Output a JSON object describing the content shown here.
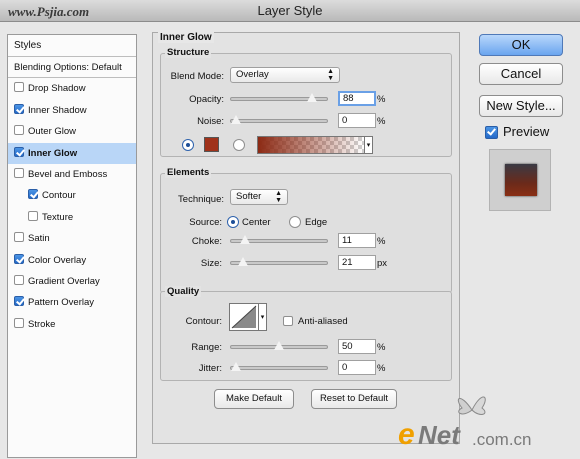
{
  "window": {
    "title": "Layer Style",
    "watermark": "www.Psjia.com"
  },
  "sidebar": {
    "header": "Styles",
    "items": [
      {
        "label": "Blending Options: Default",
        "checkbox": false,
        "checked": false,
        "selected": false,
        "indent": false
      },
      {
        "label": "Drop Shadow",
        "checkbox": true,
        "checked": false,
        "selected": false,
        "indent": false
      },
      {
        "label": "Inner Shadow",
        "checkbox": true,
        "checked": true,
        "selected": false,
        "indent": false
      },
      {
        "label": "Outer Glow",
        "checkbox": true,
        "checked": false,
        "selected": false,
        "indent": false
      },
      {
        "label": "Inner Glow",
        "checkbox": true,
        "checked": true,
        "selected": true,
        "indent": false
      },
      {
        "label": "Bevel and Emboss",
        "checkbox": true,
        "checked": false,
        "selected": false,
        "indent": false
      },
      {
        "label": "Contour",
        "checkbox": true,
        "checked": true,
        "selected": false,
        "indent": true
      },
      {
        "label": "Texture",
        "checkbox": true,
        "checked": false,
        "selected": false,
        "indent": true
      },
      {
        "label": "Satin",
        "checkbox": true,
        "checked": false,
        "selected": false,
        "indent": false
      },
      {
        "label": "Color Overlay",
        "checkbox": true,
        "checked": true,
        "selected": false,
        "indent": false
      },
      {
        "label": "Gradient Overlay",
        "checkbox": true,
        "checked": false,
        "selected": false,
        "indent": false
      },
      {
        "label": "Pattern Overlay",
        "checkbox": true,
        "checked": true,
        "selected": false,
        "indent": false
      },
      {
        "label": "Stroke",
        "checkbox": true,
        "checked": false,
        "selected": false,
        "indent": false
      }
    ]
  },
  "panel": {
    "title": "Inner Glow",
    "structure": {
      "title": "Structure",
      "blend_mode_label": "Blend Mode:",
      "blend_mode_value": "Overlay",
      "opacity_label": "Opacity:",
      "opacity_value": "88",
      "opacity_unit": "%",
      "opacity_level": 0.88,
      "noise_label": "Noise:",
      "noise_value": "0",
      "noise_unit": "%",
      "noise_level": 0.0,
      "glow_color": "#a0321a",
      "gradient_start": "#8c2a14"
    },
    "elements": {
      "title": "Elements",
      "technique_label": "Technique:",
      "technique_value": "Softer",
      "source_label": "Source:",
      "source_center": "Center",
      "source_edge": "Edge",
      "choke_label": "Choke:",
      "choke_value": "11",
      "choke_unit": "%",
      "choke_level": 0.11,
      "size_label": "Size:",
      "size_value": "21",
      "size_unit": "px",
      "size_level": 0.084
    },
    "quality": {
      "title": "Quality",
      "contour_label": "Contour:",
      "anti_aliased_label": "Anti-aliased",
      "range_label": "Range:",
      "range_value": "50",
      "range_unit": "%",
      "range_level": 0.5,
      "jitter_label": "Jitter:",
      "jitter_value": "0",
      "jitter_unit": "%",
      "jitter_level": 0.0
    },
    "make_default": "Make Default",
    "reset_default": "Reset to Default"
  },
  "buttons": {
    "ok": "OK",
    "cancel": "Cancel",
    "new_style": "New Style...",
    "preview_label": "Preview"
  },
  "watermark_bottom": {
    "e": "e",
    "net": "Net",
    "domain": ".com.cn"
  }
}
